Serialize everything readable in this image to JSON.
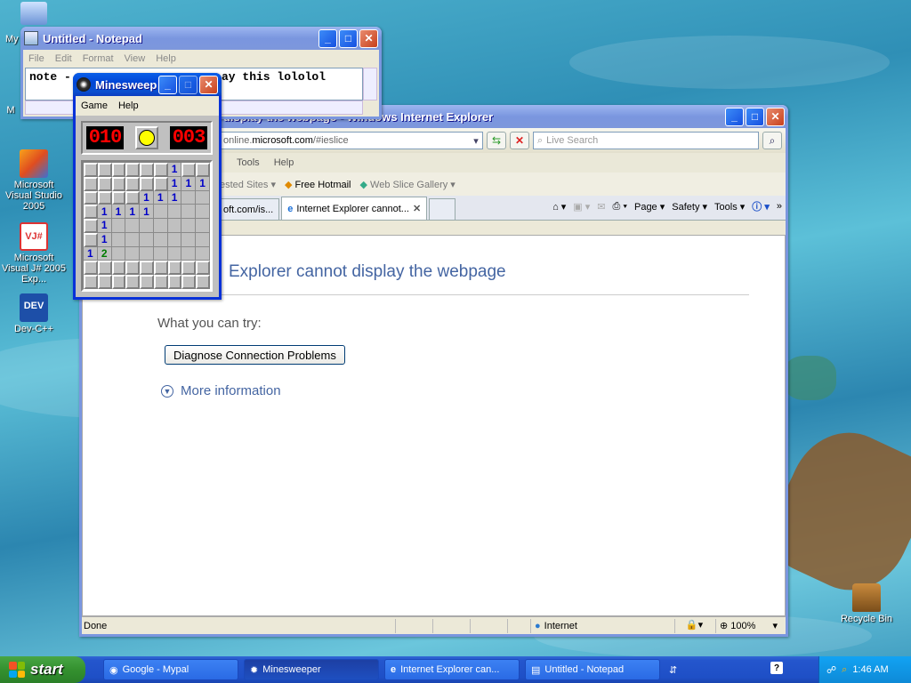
{
  "desktop": {
    "icons": [
      {
        "label": "My",
        "pic": "my-computer-icon"
      },
      {
        "label": "M",
        "pic": "my-documents-icon"
      },
      {
        "label": "Microsoft Visual Studio 2005",
        "pic": "visual-studio-icon"
      },
      {
        "label": "Microsoft Visual J# 2005 Exp...",
        "pic": "visual-jsharp-icon"
      },
      {
        "label": "Dev-C++",
        "pic": "dev-cpp-icon"
      },
      {
        "label": "Recycle Bin",
        "pic": "recycle-bin-icon"
      }
    ]
  },
  "notepad": {
    "title": "Untitled - Notepad",
    "menu": [
      "File",
      "Edit",
      "Format",
      "View",
      "Help"
    ],
    "text_left": "note -",
    "text_right": "ay this lololol"
  },
  "minesweeper": {
    "title": "Minesweeper",
    "title_short": "Minesweeper...",
    "menu": [
      "Game",
      "Help"
    ],
    "mines_left": "010",
    "timer": "003",
    "grid": [
      [
        "U",
        "U",
        "U",
        "U",
        "U",
        "U",
        "1",
        "U",
        "U"
      ],
      [
        "U",
        "U",
        "U",
        "U",
        "U",
        "U",
        "1",
        "1",
        "1"
      ],
      [
        "U",
        "U",
        "U",
        "U",
        "1",
        "1",
        "1",
        "E",
        "E"
      ],
      [
        "U",
        "1",
        "1",
        "1",
        "1",
        "E",
        "E",
        "E",
        "E"
      ],
      [
        "U",
        "1",
        "E",
        "E",
        "E",
        "E",
        "E",
        "E",
        "E"
      ],
      [
        "U",
        "1",
        "E",
        "E",
        "E",
        "E",
        "E",
        "E",
        "E"
      ],
      [
        "1",
        "2",
        "E",
        "E",
        "E",
        "E",
        "E",
        "E",
        "E"
      ],
      [
        "U",
        "U",
        "U",
        "U",
        "U",
        "U",
        "U",
        "U",
        "U"
      ],
      [
        "U",
        "U",
        "U",
        "U",
        "U",
        "U",
        "U",
        "U",
        "U"
      ]
    ]
  },
  "ie": {
    "title": "t display the webpage - Windows Internet Explorer",
    "address_prefix": "online.",
    "address_domain": "microsoft.com",
    "address_suffix": "/#ieslice",
    "search_placeholder": "Live Search",
    "menu": [
      "Tools",
      "Help"
    ],
    "favorites": {
      "suggested": "ested Sites",
      "hotmail": "Free Hotmail",
      "slice": "Web Slice Gallery"
    },
    "tabs": [
      {
        "label": "oft.com/is..."
      },
      {
        "label": "Internet Explorer cannot..."
      }
    ],
    "commands": {
      "page": "Page",
      "safety": "Safety",
      "tools": "Tools"
    },
    "content": {
      "heading": "Explorer cannot display the webpage",
      "try_label": "What you can try:",
      "diagnose_button": "Diagnose Connection Problems",
      "more_info": "More information"
    },
    "status": {
      "text": "Done",
      "zone": "Internet",
      "zoom": "100%"
    }
  },
  "taskbar": {
    "start_label": "start",
    "tasks": [
      {
        "label": "Google - Mypal",
        "active": false
      },
      {
        "label": "Minesweeper",
        "active": true
      },
      {
        "label": "Internet Explorer can...",
        "active": false
      },
      {
        "label": "Untitled - Notepad",
        "active": false
      }
    ],
    "help_glyph": "?",
    "clock": "1:46 AM"
  }
}
